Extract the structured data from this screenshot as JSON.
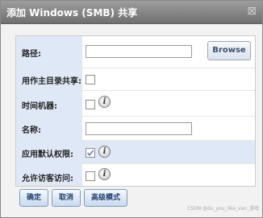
{
  "dialog": {
    "title": "添加 Windows (SMB) 共享",
    "close_symbol": "⊠"
  },
  "form": {
    "path_label": "路径:",
    "path_value": "",
    "browse_label": "Browse",
    "home_share_label": "用作主目录共享:",
    "home_share_checked": false,
    "time_machine_label": "时间机器:",
    "time_machine_checked": false,
    "name_label": "名称:",
    "name_value": "",
    "default_perms_label": "应用默认权限:",
    "default_perms_checked": true,
    "guest_access_label": "允许访客访问:",
    "guest_access_checked": false,
    "info_glyph": "i"
  },
  "footer": {
    "ok_label": "确定",
    "cancel_label": "取消",
    "advanced_label": "高级模式"
  },
  "watermark": "CSDN @du_you_like_van_游戏",
  "colors": {
    "titlebar": "#7f7f7f",
    "label_bg": "#dfe8f6",
    "button_text": "#1f3f6e"
  },
  "icons": [
    "close-icon",
    "info-icon",
    "checkmark-icon"
  ]
}
